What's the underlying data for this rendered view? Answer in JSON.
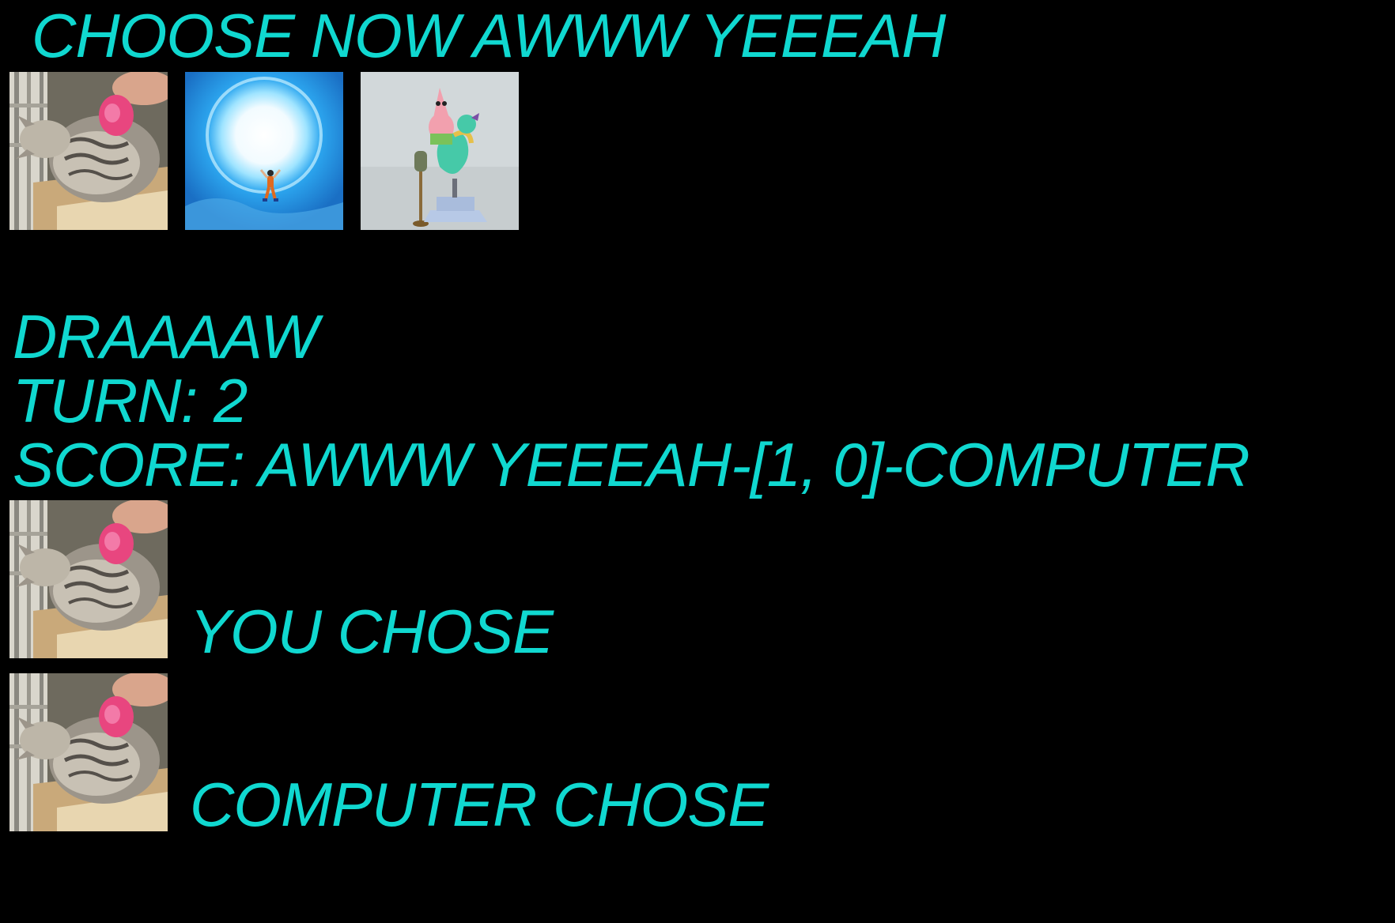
{
  "title": "CHOOSE NOW AWWW YEEEAH",
  "choices": [
    {
      "icon": "cat-being-petted-icon"
    },
    {
      "icon": "energy-blast-icon"
    },
    {
      "icon": "patrick-seahorse-icon"
    }
  ],
  "status": {
    "result": "DRAAAAW",
    "turn": "TURN: 2",
    "score": "SCORE: AWWW YEEEAH-[1, 0]-COMPUTER"
  },
  "player": {
    "label": "YOU CHOSE",
    "icon": "cat-being-petted-icon"
  },
  "computer": {
    "label": "COMPUTER CHOSE",
    "icon": "cat-being-petted-icon"
  },
  "colors": {
    "background": "#000000",
    "text": "#10d8d0"
  }
}
